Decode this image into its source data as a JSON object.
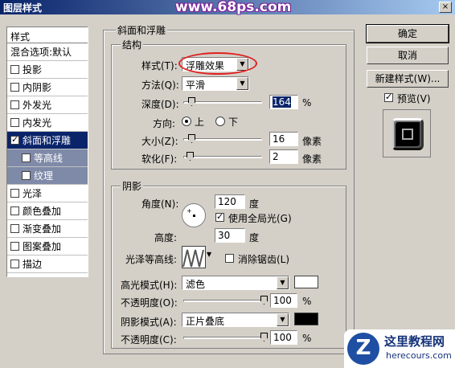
{
  "window": {
    "title": "图层样式",
    "watermark": "www.68ps.com",
    "close": "×"
  },
  "styles_panel": {
    "header": "样式",
    "blend_options": "混合选项:默认",
    "items": [
      {
        "label": "投影",
        "checked": false
      },
      {
        "label": "内阴影",
        "checked": false
      },
      {
        "label": "外发光",
        "checked": false
      },
      {
        "label": "内发光",
        "checked": false
      },
      {
        "label": "斜面和浮雕",
        "checked": true,
        "selected": true
      },
      {
        "label": "等高线",
        "checked": false,
        "sub": true
      },
      {
        "label": "纹理",
        "checked": false,
        "sub": true
      },
      {
        "label": "光泽",
        "checked": false
      },
      {
        "label": "颜色叠加",
        "checked": false
      },
      {
        "label": "渐变叠加",
        "checked": false
      },
      {
        "label": "图案叠加",
        "checked": false
      },
      {
        "label": "描边",
        "checked": false
      }
    ]
  },
  "bevel": {
    "title": "斜面和浮雕",
    "structure": {
      "title": "结构",
      "style_label": "样式(T):",
      "style_value": "浮雕效果",
      "technique_label": "方法(Q):",
      "technique_value": "平滑",
      "depth_label": "深度(D):",
      "depth_value": "164",
      "depth_unit": "%",
      "direction_label": "方向:",
      "direction_up": "上",
      "direction_down": "下",
      "size_label": "大小(Z):",
      "size_value": "16",
      "size_unit": "像素",
      "soften_label": "软化(F):",
      "soften_value": "2",
      "soften_unit": "像素"
    },
    "shading": {
      "title": "阴影",
      "angle_label": "角度(N):",
      "angle_value": "120",
      "angle_unit": "度",
      "global_light": "使用全局光(G)",
      "altitude_label": "高度:",
      "altitude_value": "30",
      "altitude_unit": "度",
      "gloss_label": "光泽等高线:",
      "antialias": "消除锯齿(L)",
      "highlight_mode_label": "高光模式(H):",
      "highlight_mode_value": "滤色",
      "highlight_color": "#ffffff",
      "opacity1_label": "不透明度(O):",
      "opacity1_value": "100",
      "opacity_unit": "%",
      "shadow_mode_label": "阴影模式(A):",
      "shadow_mode_value": "正片叠底",
      "shadow_color": "#000000",
      "opacity2_label": "不透明度(C):",
      "opacity2_value": "100"
    }
  },
  "buttons": {
    "ok": "确定",
    "cancel": "取消",
    "new_style": "新建样式(W)...",
    "preview": "预览(V)"
  },
  "logo": {
    "mark": "Z",
    "line1": "这里教程网",
    "line2": "herecours.com"
  }
}
